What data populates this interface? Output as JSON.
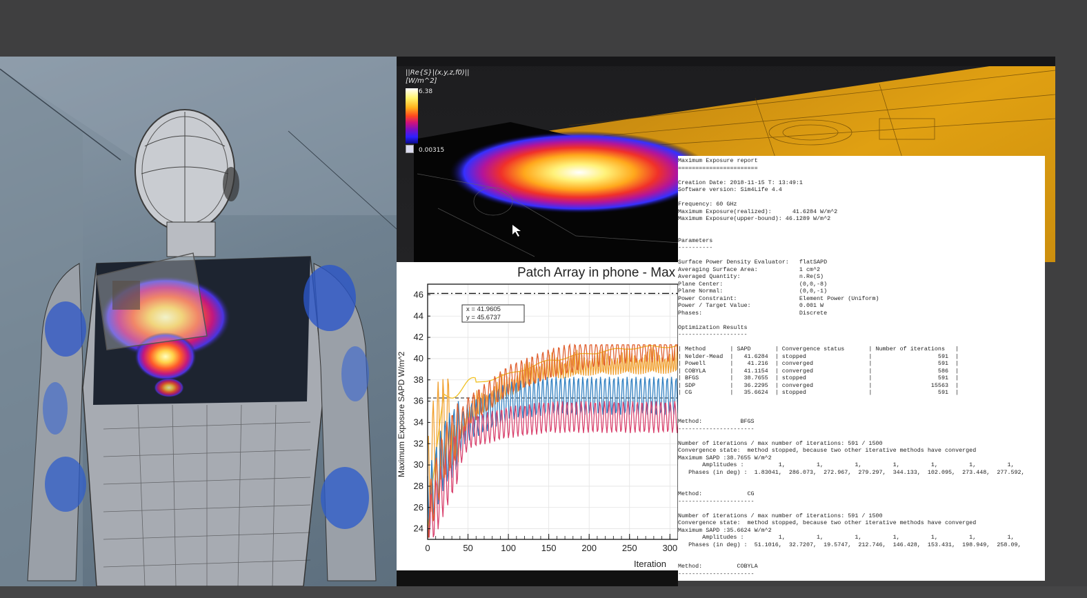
{
  "colorbar": {
    "title_line1": "||Re{S}|(x,y,z,f0)||",
    "title_line2": "[W/m^2]",
    "max_label": "6.38",
    "min_label": "0.00315"
  },
  "chart": {
    "title": "Patch Array in phone - Max",
    "ylabel": "Maximum Exposure SAPD W/m^2",
    "xlabel": "Iteration",
    "tooltip_x": "x = 41.9605",
    "tooltip_y": "y = 45.6737",
    "y_ticks": [
      "24",
      "26",
      "28",
      "30",
      "32",
      "34",
      "36",
      "38",
      "40",
      "42",
      "44",
      "46"
    ],
    "x_ticks": [
      "0",
      "50",
      "100",
      "150",
      "200",
      "250",
      "300",
      "3"
    ]
  },
  "chart_data": {
    "type": "line",
    "title": "Patch Array in phone - Max",
    "xlabel": "Iteration",
    "ylabel": "Maximum Exposure SAPD W/m^2",
    "xlim": [
      0,
      310
    ],
    "ylim": [
      23,
      47
    ],
    "reference_lines": [
      46.13,
      36.3
    ],
    "series": [
      {
        "color": "#f0c020",
        "x": [
          0,
          20,
          50,
          100,
          150,
          200,
          250,
          310
        ],
        "y": [
          24,
          36.5,
          37.5,
          38.5,
          39.8,
          40.5,
          41,
          41.2
        ]
      },
      {
        "color": "#f0a030",
        "x": [
          0,
          10,
          30,
          60,
          100,
          140,
          200,
          250,
          310
        ],
        "y": [
          28,
          33,
          34,
          37,
          39,
          40.5,
          41,
          41.1,
          41.2
        ]
      },
      {
        "color": "#2f7fc1",
        "x": [
          0,
          20,
          50,
          100,
          150,
          200,
          250,
          310
        ],
        "y": [
          26,
          31,
          34,
          36,
          36.5,
          36.5,
          36.5,
          36.5
        ]
      },
      {
        "color": "#d9436e",
        "x": [
          0,
          20,
          50,
          100,
          150,
          200,
          250,
          310
        ],
        "y": [
          24,
          28,
          33,
          34,
          34.5,
          34.5,
          34.5,
          34.5
        ]
      },
      {
        "color": "#e06030",
        "x": [
          0,
          20,
          50,
          100,
          150,
          200,
          250,
          310
        ],
        "y": [
          25,
          31,
          35,
          38,
          39.5,
          40.5,
          41,
          41.1
        ]
      }
    ]
  },
  "report": {
    "lines": [
      "Maximum Exposure report",
      "=======================",
      "",
      "Creation Date: 2018-11-15 T: 13:49:1",
      "Software version: Sim4Life 4.4",
      "",
      "Frequency: 60 GHz",
      "Maximum Exposure(realized):      41.6284 W/m^2",
      "Maximum Exposure(upper-bound): 46.1289 W/m^2",
      "",
      "",
      "Parameters",
      "----------",
      "",
      "Surface Power Density Evaluator:   flatSAPD",
      "Averaging Surface Area:            1 cm^2",
      "Averaged Quantity:                 n.Re(S)",
      "Plane Center:                      (0,0,-8)",
      "Plane Normal:                      (0,0,-1)",
      "Power Constraint:                  Element Power (Uniform)",
      "Power / Target Value:              0.001 W",
      "Phases:                            Discrete",
      "",
      "Optimization Results",
      "--------------------",
      "",
      "| Method       | SAPD       | Convergence status       | Number of iterations   |",
      "| Nelder-Mead  |   41.6284  | stopped                  |                   591  |",
      "| Powell       |    41.216  | converged                |                   591  |",
      "| COBYLA       |   41.1154  | converged                |                   586  |",
      "| BFGS         |   38.7655  | stopped                  |                   591  |",
      "| SDP          |   36.2295  | converged                |                 15563  |",
      "| CG           |   35.6624  | stopped                  |                   591  |",
      "",
      "",
      "",
      "Method:           BFGS",
      "----------------------",
      "",
      "Number of iterations / max number of iterations: 591 / 1500",
      "Convergence state:  method stopped, because two other iterative methods have converged",
      "Maximum SAPD :38.7655 W/m^2",
      "       Amplitudes :          1,         1,         1,         1,         1,         1,         1,         1,",
      "   Phases (in deg) :  1.83041,  286.073,  272.967,  279.297,  344.133,  102.095,  273.448,  277.592,",
      "",
      "",
      "Method:             CG",
      "----------------------",
      "",
      "Number of iterations / max number of iterations: 591 / 1500",
      "Convergence state:  method stopped, because two other iterative methods have converged",
      "Maximum SAPD :35.6624 W/m^2",
      "       Amplitudes :          1,         1,         1,         1,         1,         1,         1,         1,",
      "   Phases (in deg) :  51.1016,  32.7207,  19.5747,  212.746,  146.428,  153.431,  198.949,  258.09,",
      "",
      "",
      "Method:          COBYLA",
      "----------------------"
    ]
  }
}
